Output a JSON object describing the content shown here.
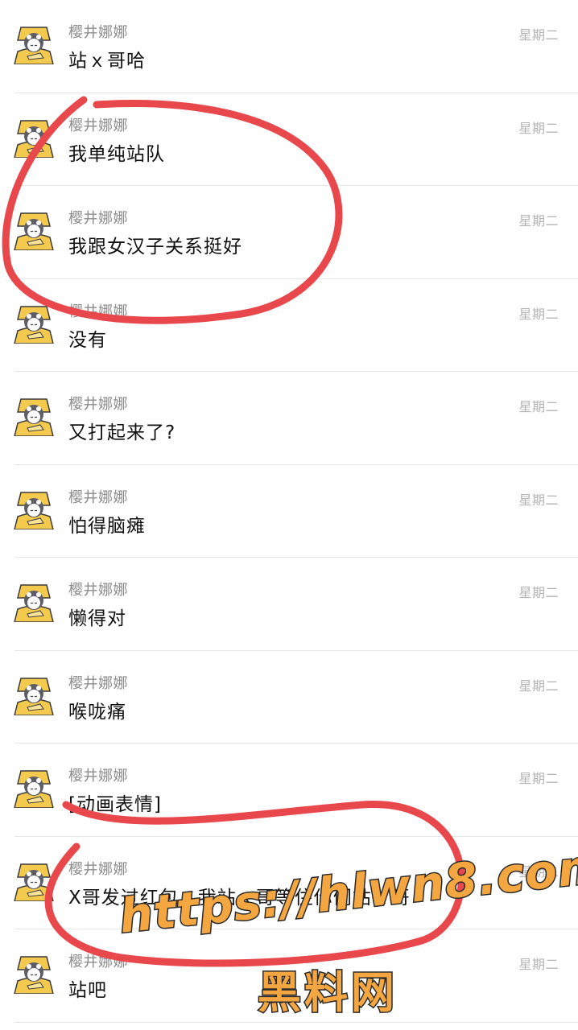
{
  "messages": [
    {
      "name": "樱井娜娜",
      "text": "站ｘ哥哈",
      "time": "星期二"
    },
    {
      "name": "樱井娜娜",
      "text": "我单纯站队",
      "time": "星期二"
    },
    {
      "name": "樱井娜娜",
      "text": "我跟女汉子关系挺好",
      "time": "星期二"
    },
    {
      "name": "樱井娜娜",
      "text": "没有",
      "time": "星期二"
    },
    {
      "name": "樱井娜娜",
      "text": "又打起来了?",
      "time": "星期二"
    },
    {
      "name": "樱井娜娜",
      "text": "怕得脑瘫",
      "time": "星期二"
    },
    {
      "name": "樱井娜娜",
      "text": "懒得对",
      "time": "星期二"
    },
    {
      "name": "樱井娜娜",
      "text": "喉咙痛",
      "time": "星期二"
    },
    {
      "name": "樱井娜娜",
      "text": "[动画表情]",
      "time": "星期二"
    },
    {
      "name": "樱井娜娜",
      "text": "X哥发过红包，我站ｘ哥等住你们站ｘ哥",
      "time": "星期二"
    },
    {
      "name": "樱井娜娜",
      "text": "站吧",
      "time": "星期二"
    }
  ],
  "watermark": {
    "url": "https://hlwn8.com",
    "label": "黑料网"
  },
  "colors": {
    "annotation_red": "#e8474c",
    "watermark_orange": "#f4a640",
    "avatar_yellow": "#f3c94e"
  },
  "icons": {
    "avatar": "cartoon-girl-avatar-icon"
  }
}
